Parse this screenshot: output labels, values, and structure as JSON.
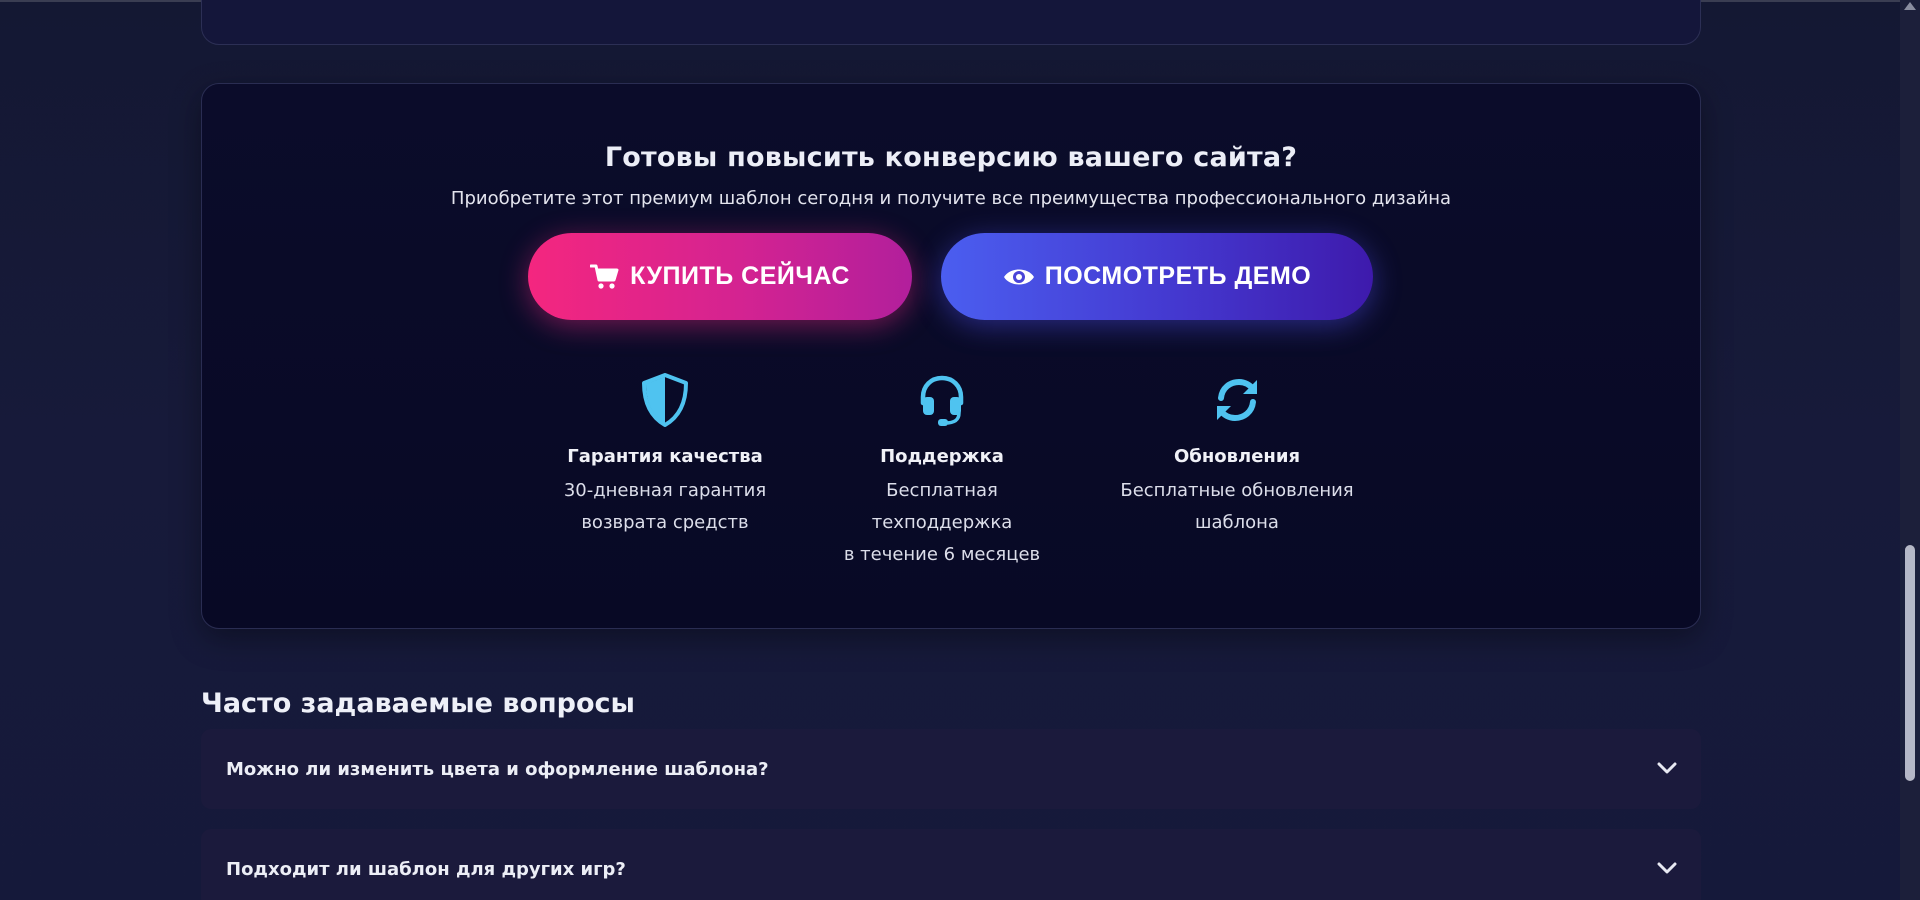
{
  "cta": {
    "title": "Готовы повысить конверсию вашего сайта?",
    "subtitle": "Приобретите этот премиум шаблон сегодня и получите все преимущества профессионального дизайна",
    "buy_label": "КУПИТЬ СЕЙЧАС",
    "demo_label": "ПОСМОТРЕТЬ ДЕМО",
    "buy_icon": "cart-icon",
    "demo_icon": "eye-icon"
  },
  "features": [
    {
      "icon": "shield-icon",
      "title": "Гарантия качества",
      "line1": "30-дневная гарантия",
      "line2": "возврата средств"
    },
    {
      "icon": "headset-icon",
      "title": "Поддержка",
      "line1": "Бесплатная техподдержка",
      "line2": "в течение 6 месяцев"
    },
    {
      "icon": "sync-icon",
      "title": "Обновления",
      "line1": "Бесплатные обновления",
      "line2": "шаблона"
    }
  ],
  "faq": {
    "title": "Часто задаваемые вопросы",
    "items": [
      {
        "question": "Можно ли изменить цвета и оформление шаблона?"
      },
      {
        "question": "Подходит ли шаблон для других игр?"
      }
    ]
  },
  "colors": {
    "accent_pink": "#f4267f",
    "accent_blue": "#4b5ef0",
    "icon_cyan": "#4fc3f0",
    "background": "#141833"
  }
}
